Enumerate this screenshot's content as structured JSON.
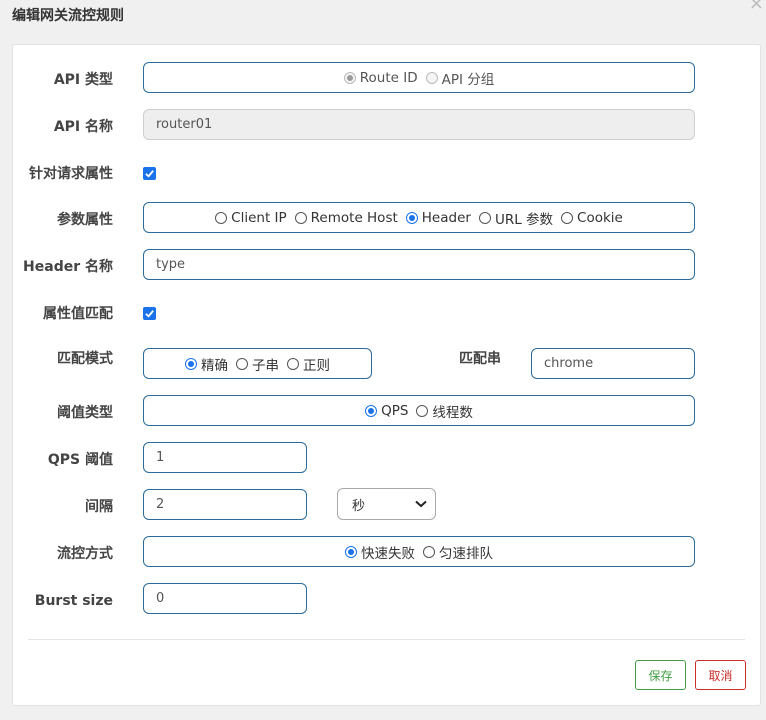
{
  "dialog": {
    "title": "编辑网关流控规则"
  },
  "labels": {
    "api_type": "API 类型",
    "api_name": "API 名称",
    "param_flag": "针对请求属性",
    "param_attr": "参数属性",
    "header_name": "Header 名称",
    "match_flag": "属性值匹配",
    "match_mode": "匹配模式",
    "match_str": "匹配串",
    "grade": "阈值类型",
    "qps_count": "QPS 阈值",
    "interval": "间隔",
    "control": "流控方式",
    "burst": "Burst size"
  },
  "api_type": {
    "options": [
      "Route ID",
      "API 分组"
    ],
    "selected": "Route ID"
  },
  "api_name": {
    "value": "router01"
  },
  "param_attr": {
    "options": [
      "Client IP",
      "Remote Host",
      "Header",
      "URL 参数",
      "Cookie"
    ],
    "selected": "Header"
  },
  "header_name": {
    "value": "type"
  },
  "match_mode": {
    "options": [
      "精确",
      "子串",
      "正则"
    ],
    "selected": "精确"
  },
  "match_str": {
    "value": "chrome"
  },
  "grade": {
    "options": [
      "QPS",
      "线程数"
    ],
    "selected": "QPS"
  },
  "qps_count": {
    "value": "1"
  },
  "interval": {
    "value": "2",
    "unit": "秒"
  },
  "control": {
    "options": [
      "快速失败",
      "匀速排队"
    ],
    "selected": "快速失败"
  },
  "burst": {
    "value": "0"
  },
  "buttons": {
    "save": "保存",
    "cancel": "取消"
  },
  "colors": {
    "accent": "#1a73e8",
    "border": "#2d6b99",
    "save": "#449d44",
    "cancel": "#c9302c"
  }
}
